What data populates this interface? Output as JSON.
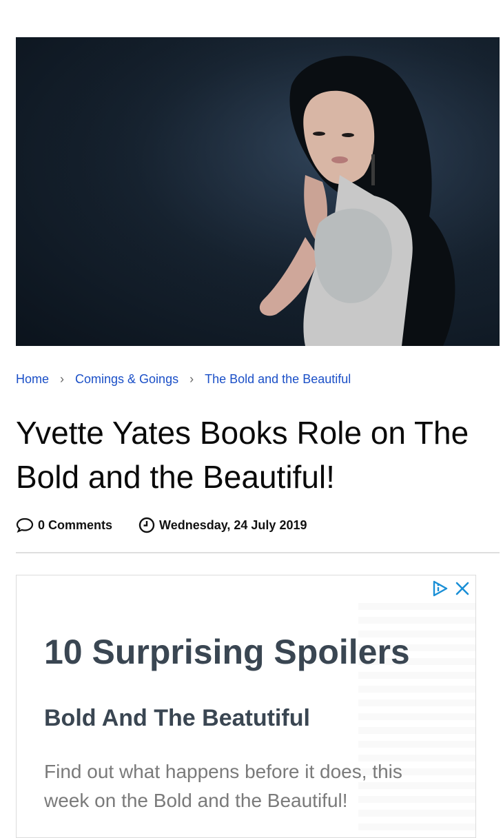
{
  "hero": {
    "image_alt": ""
  },
  "breadcrumb": {
    "items": [
      "Home",
      "Comings & Goings",
      "The Bold and the Beautiful"
    ],
    "separator": "›"
  },
  "article": {
    "title": "Yvette Yates Books Role on The Bold and the Beautiful!",
    "comments": "0 Comments",
    "date": "Wednesday, 24 July 2019"
  },
  "ad": {
    "headline": "10 Surprising Spoilers",
    "subheadline": "Bold And The Beatutiful",
    "body": "Find out what happens before it does, this week on the Bold and the Beautiful!",
    "icons": [
      "adchoices-icon",
      "close-icon"
    ]
  },
  "colors": {
    "link": "#1a4fc7",
    "ad_text": "#3a4652",
    "ad_body": "#7a7a7a",
    "hero_bg": "#16222f"
  }
}
